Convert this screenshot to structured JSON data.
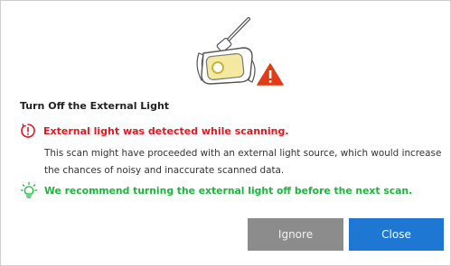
{
  "dialog": {
    "title": "Turn Off the External Light",
    "warning_icon": "exclamation-circle-icon",
    "warning_text": "External light was detected while scanning.",
    "description": "This scan might have proceeded with an external light source, which would increase the chances of noisy and inaccurate scanned data.",
    "tip_icon": "lightbulb-icon",
    "tip_text": "We recommend turning the external light off before the next scan.",
    "illustration": "overhead-light-warning-illustration"
  },
  "buttons": {
    "ignore_label": "Ignore",
    "close_label": "Close"
  },
  "colors": {
    "warning": "#e8141e",
    "tip": "#18b83a",
    "primary": "#1e77d2",
    "secondary": "#8c8c8c",
    "alert_triangle": "#e33b14"
  }
}
